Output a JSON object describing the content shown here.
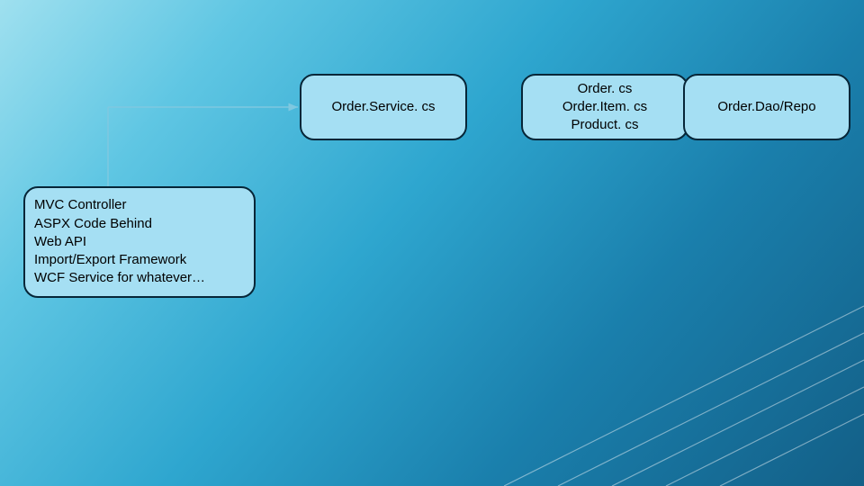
{
  "diagram": {
    "boxes": {
      "service": "Order.Service. cs",
      "domain": "Order. cs\nOrder.Item. cs\nProduct. cs",
      "repo": "Order.Dao/Repo",
      "clients": "MVC Controller\nASPX Code Behind\nWeb API\nImport/Export Framework\nWCF Service for whatever…"
    }
  }
}
